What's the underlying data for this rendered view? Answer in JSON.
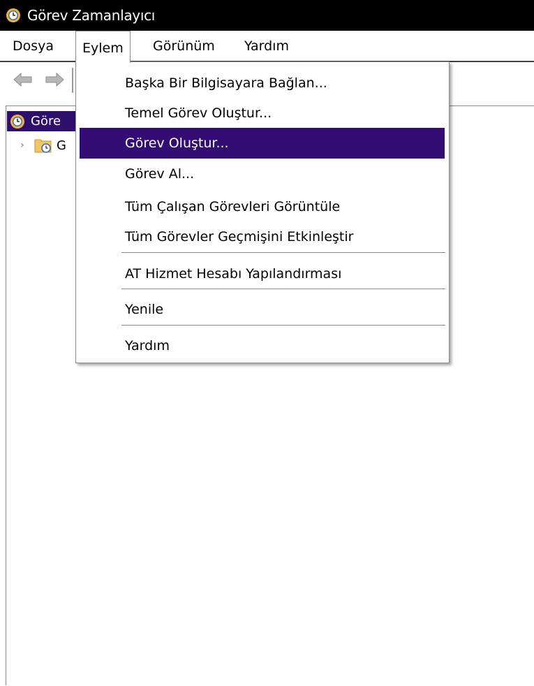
{
  "window": {
    "title": "Görev Zamanlayıcı",
    "icon": "clock-icon"
  },
  "menubar": {
    "items": [
      {
        "label": "Dosya"
      },
      {
        "label": "Eylem",
        "active": true
      },
      {
        "label": "Görünüm"
      },
      {
        "label": "Yardım"
      }
    ]
  },
  "toolbar": {
    "back_icon": "back-arrow-icon",
    "forward_icon": "forward-arrow-icon"
  },
  "tree": {
    "root_label": "Göre",
    "child_label": "G"
  },
  "dropdown": {
    "items": [
      {
        "label": "Başka Bir Bilgisayara Bağlan..."
      },
      {
        "label": "Temel Görev Oluştur..."
      },
      {
        "label": "Görev Oluştur...",
        "highlighted": true
      },
      {
        "label": "Görev Al..."
      },
      {
        "label": "Tüm Çalışan Görevleri Görüntüle"
      },
      {
        "label": "Tüm Görevler Geçmişini Etkinleştir"
      },
      {
        "label": "AT Hizmet Hesabı Yapılandırması"
      },
      {
        "label": "Yenile"
      },
      {
        "label": "Yardım"
      }
    ]
  },
  "colors": {
    "titlebar_bg": "#000000",
    "highlight": "#330c74",
    "tree_selected": "#2f0f6e"
  }
}
